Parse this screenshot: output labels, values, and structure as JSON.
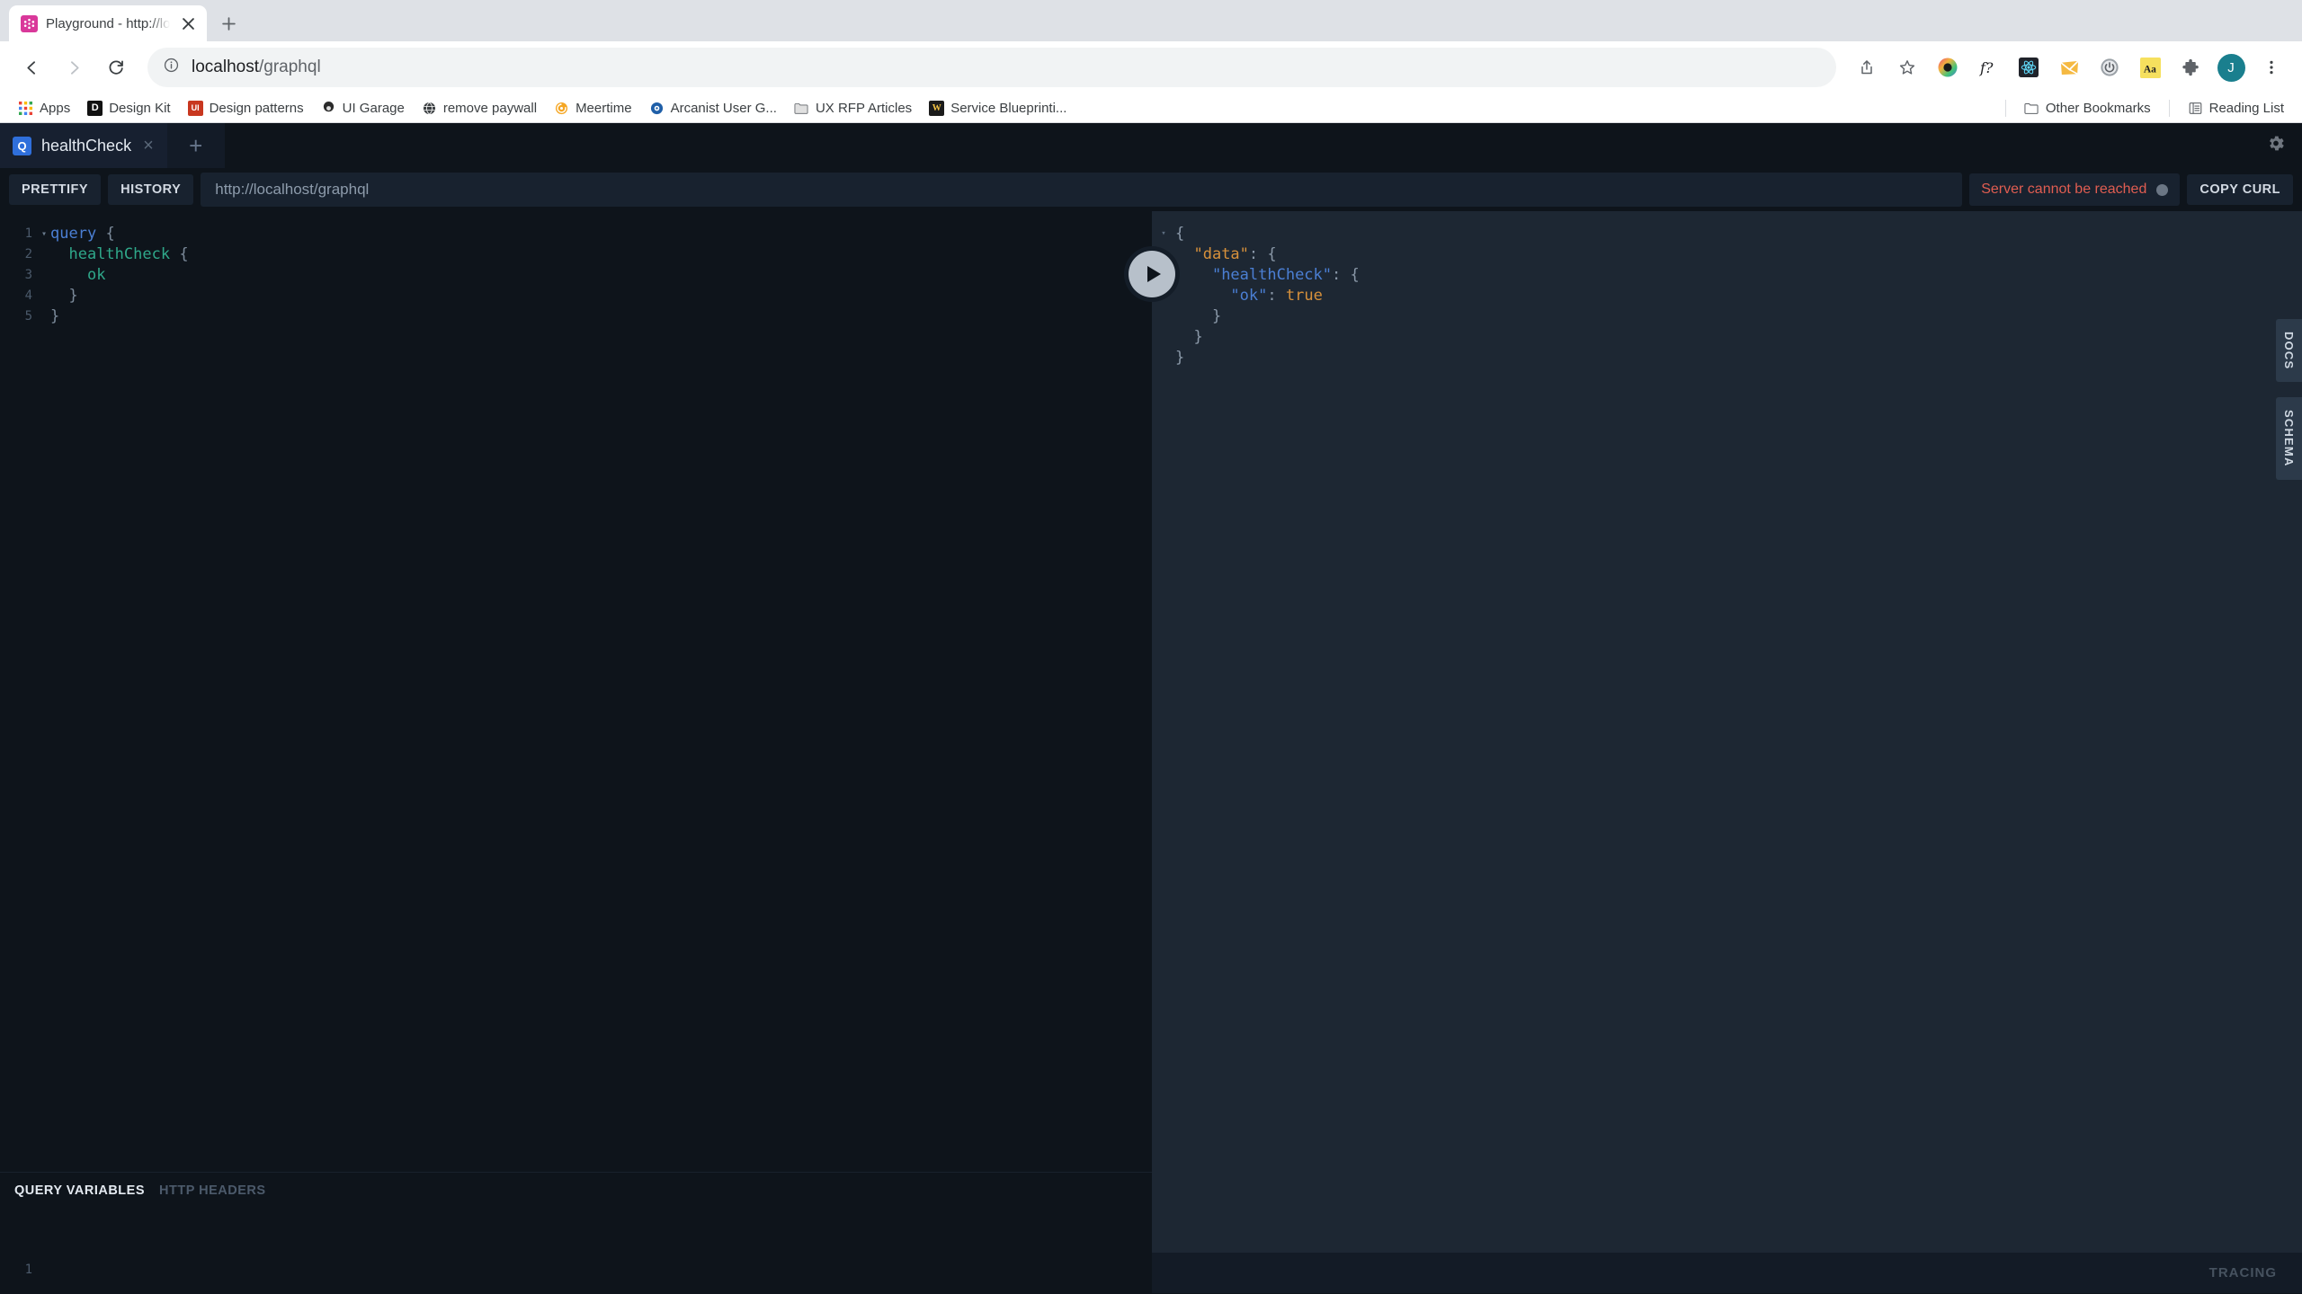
{
  "browser": {
    "tab": {
      "title": "Playground - http://localhost/g",
      "favicon": "graphql-logo-icon",
      "close": "×"
    },
    "new_tab_label": "+",
    "nav": {
      "back": "back-icon",
      "forward": "forward-icon",
      "reload": "reload-icon"
    },
    "omnibox": {
      "info_icon": "info-icon",
      "host": "localhost",
      "path": "/graphql"
    },
    "toolbar_icons": [
      "share-icon",
      "bookmark-star-icon",
      "colorful-circle-extension-icon",
      "f-question-extension-icon",
      "react-devtools-icon",
      "envelope-extension-icon",
      "power-toggle-extension-icon",
      "aa-font-extension-icon",
      "puzzle-extensions-icon"
    ],
    "profile_initial": "J",
    "menu_icon": "kebab-menu-icon",
    "bookmarks": [
      {
        "label": "Apps",
        "icon": "apps-grid-icon"
      },
      {
        "label": "Design Kit",
        "icon": "d-letter-icon"
      },
      {
        "label": "Design patterns",
        "icon": "ui-letter-icon"
      },
      {
        "label": "UI Garage",
        "icon": "garage-icon"
      },
      {
        "label": "remove paywall",
        "icon": "globe-icon"
      },
      {
        "label": "Meertime",
        "icon": "meertime-icon"
      },
      {
        "label": "Arcanist User G...",
        "icon": "arcanist-icon"
      },
      {
        "label": "UX RFP Articles",
        "icon": "folder-icon"
      },
      {
        "label": "Service Blueprinti...",
        "icon": "blueprint-icon"
      }
    ],
    "other_bookmarks": {
      "label": "Other Bookmarks",
      "icon": "folder-icon"
    },
    "reading_list": {
      "label": "Reading List",
      "icon": "reading-list-icon"
    }
  },
  "playground": {
    "tab": {
      "badge": "Q",
      "label": "healthCheck",
      "close": "×"
    },
    "new_tab": "+",
    "settings_icon": "gear-icon",
    "toolbar": {
      "prettify": "PRETTIFY",
      "history": "HISTORY",
      "endpoint": "http://localhost/graphql",
      "status_text": "Server cannot be reached",
      "status_color": "#e05d51",
      "copy_curl": "COPY CURL"
    },
    "query_editor": {
      "lines": [
        {
          "num": "1",
          "fold": "▾",
          "tokens": [
            {
              "t": "query",
              "c": "k-query"
            },
            {
              "t": " ",
              "c": "ctext"
            },
            {
              "t": "{",
              "c": "k-brace"
            }
          ]
        },
        {
          "num": "2",
          "fold": "",
          "tokens": [
            {
              "t": "  ",
              "c": "ctext"
            },
            {
              "t": "healthCheck",
              "c": "k-field"
            },
            {
              "t": " ",
              "c": "ctext"
            },
            {
              "t": "{",
              "c": "k-brace"
            }
          ]
        },
        {
          "num": "3",
          "fold": "",
          "tokens": [
            {
              "t": "    ",
              "c": "ctext"
            },
            {
              "t": "ok",
              "c": "k-field"
            }
          ]
        },
        {
          "num": "4",
          "fold": "",
          "tokens": [
            {
              "t": "  ",
              "c": "ctext"
            },
            {
              "t": "}",
              "c": "k-brace"
            }
          ]
        },
        {
          "num": "5",
          "fold": "",
          "tokens": [
            {
              "t": "}",
              "c": "k-brace"
            }
          ]
        }
      ]
    },
    "variables_panel": {
      "tabs": [
        {
          "label": "QUERY VARIABLES",
          "active": true
        },
        {
          "label": "HTTP HEADERS",
          "active": false
        }
      ],
      "line_number": "1",
      "content": ""
    },
    "response": {
      "lines": [
        {
          "fold": "▾",
          "tokens": [
            {
              "t": "{",
              "c": "r-punct"
            }
          ]
        },
        {
          "fold": "▾",
          "tokens": [
            {
              "t": "  ",
              "c": "r-punct"
            },
            {
              "t": "\"data\"",
              "c": "r-key-data"
            },
            {
              "t": ": {",
              "c": "r-punct"
            }
          ]
        },
        {
          "fold": "",
          "tokens": [
            {
              "t": "    ",
              "c": "r-punct"
            },
            {
              "t": "\"healthCheck\"",
              "c": "r-key"
            },
            {
              "t": ": {",
              "c": "r-punct"
            }
          ]
        },
        {
          "fold": "",
          "tokens": [
            {
              "t": "      ",
              "c": "r-punct"
            },
            {
              "t": "\"ok\"",
              "c": "r-key"
            },
            {
              "t": ": ",
              "c": "r-punct"
            },
            {
              "t": "true",
              "c": "r-val"
            }
          ]
        },
        {
          "fold": "",
          "tokens": [
            {
              "t": "    }",
              "c": "r-punct"
            }
          ]
        },
        {
          "fold": "",
          "tokens": [
            {
              "t": "  }",
              "c": "r-punct"
            }
          ]
        },
        {
          "fold": "",
          "tokens": [
            {
              "t": "}",
              "c": "r-punct"
            }
          ]
        }
      ]
    },
    "run_button": "play-icon",
    "side_tabs": [
      "DOCS",
      "SCHEMA"
    ],
    "tracing_label": "TRACING"
  }
}
